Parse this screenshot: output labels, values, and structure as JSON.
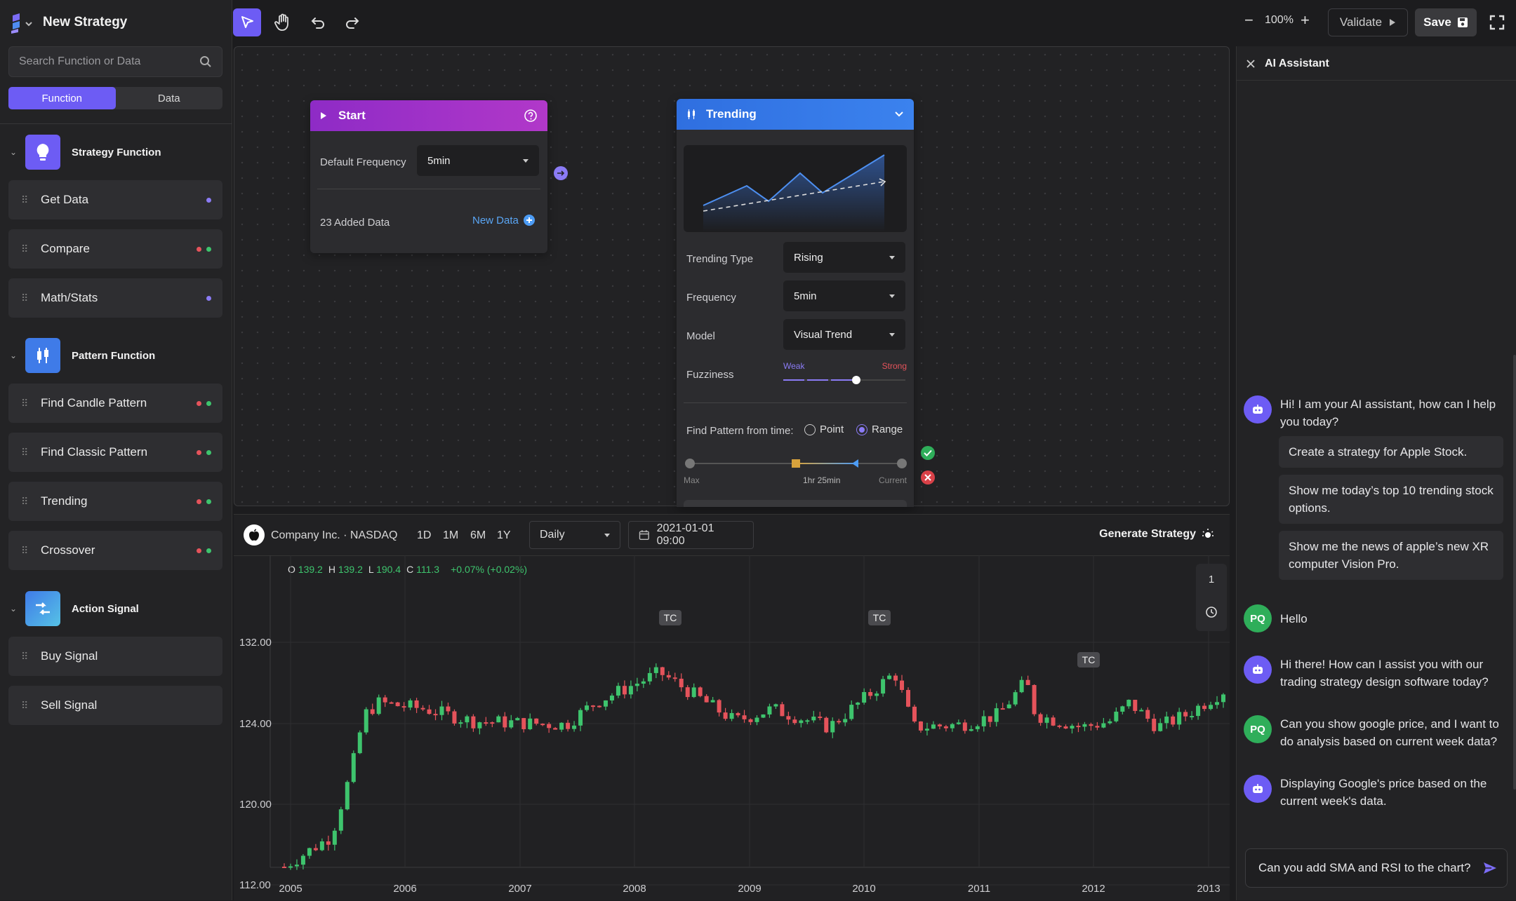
{
  "app": {
    "title": "New Strategy"
  },
  "search": {
    "placeholder": "Search Function or Data"
  },
  "tabs": [
    {
      "label": "Function",
      "active": true
    },
    {
      "label": "Data",
      "active": false
    }
  ],
  "groups": [
    {
      "label": "Strategy Function",
      "icon": "lightbulb-icon",
      "color": "#6d5cf4"
    },
    {
      "label": "Pattern Function",
      "icon": "candlestick-icon",
      "color": "#3f7be8"
    },
    {
      "label": "Action Signal",
      "icon": "swap-arrows-icon",
      "color": "#3f7be8"
    }
  ],
  "items": [
    {
      "label": "Get Data",
      "dots": [
        "#8b7bf5"
      ]
    },
    {
      "label": "Compare",
      "dots": [
        "#e5535b",
        "#3ec46d"
      ]
    },
    {
      "label": "Math/Stats",
      "dots": [
        "#8b7bf5"
      ]
    },
    {
      "label": "Find Candle Pattern",
      "dots": [
        "#e5535b",
        "#3ec46d"
      ]
    },
    {
      "label": "Find Classic Pattern",
      "dots": [
        "#e5535b",
        "#3ec46d"
      ]
    },
    {
      "label": "Trending",
      "dots": [
        "#e5535b",
        "#3ec46d"
      ]
    },
    {
      "label": "Crossover",
      "dots": [
        "#e5535b",
        "#3ec46d"
      ]
    },
    {
      "label": "Buy Signal",
      "dots": []
    },
    {
      "label": "Sell Signal",
      "dots": []
    }
  ],
  "toolbar": {
    "zoom": "100%",
    "validate": "Validate",
    "save": "Save"
  },
  "start_node": {
    "title": "Start",
    "freq_label": "Default Frequency",
    "freq_value": "5min",
    "added": "23 Added Data",
    "new_data": "New Data"
  },
  "trend_node": {
    "title": "Trending",
    "type_label": "Trending Type",
    "type_value": "Rising",
    "freq_label": "Frequency",
    "freq_value": "5min",
    "model_label": "Model",
    "model_value": "Visual Trend",
    "fuzz_label": "Fuzziness",
    "fuzz_weak": "Weak",
    "fuzz_strong": "Strong",
    "fuzz_level": 0.6,
    "find_label": "Find Pattern from time:",
    "opt_point": "Point",
    "opt_range": "Range",
    "range_max": "Max",
    "range_mid": "1hr 25min",
    "range_current": "Current"
  },
  "chart_toolbar": {
    "company": "Company Inc. · NASDAQ",
    "timeframes": [
      "1D",
      "1M",
      "6M",
      "1Y"
    ],
    "interval": "Daily",
    "date": "2021-01-01 09:00",
    "generate": "Generate Strategy",
    "side_num": "1"
  },
  "ohlc": {
    "o_label": "O",
    "o": "139.2",
    "h_label": "H",
    "h": "139.2",
    "l_label": "L",
    "l": "190.4",
    "c_label": "C",
    "c": "111.3",
    "change": "+0.07% (+0.02%)"
  },
  "chart_data": {
    "type": "candlestick",
    "x_ticks": [
      "2005",
      "2006",
      "2007",
      "2008",
      "2009",
      "2010",
      "2011",
      "2012",
      "2013"
    ],
    "y_ticks": [
      "132.00",
      "124.00",
      "120.00",
      "112.00"
    ],
    "annotations": [
      "TC",
      "TC",
      "TC"
    ],
    "colors": {
      "up": "#3ec46d",
      "down": "#e5535b"
    }
  },
  "ai": {
    "title": "AI Assistant",
    "messages": [
      {
        "who": "bot",
        "text": "Hi! I am your AI assistant, how can I help you today?"
      },
      {
        "who": "user",
        "initials": "PQ",
        "text": "Hello"
      },
      {
        "who": "bot",
        "text": "Hi there! How can I assist you with our trading strategy design software today?"
      },
      {
        "who": "user",
        "initials": "PQ",
        "text": "Can you show google price, and I want to do analysis based on current week data?"
      },
      {
        "who": "bot",
        "text": "Displaying Google's price based on the current week's data."
      }
    ],
    "suggestions": [
      "Create a strategy for Apple Stock.",
      "Show me today’s top 10 trending stock options.",
      "Show me the news of apple’s new XR computer Vision Pro."
    ],
    "input_value": "Can you add SMA and RSI to the chart?"
  }
}
